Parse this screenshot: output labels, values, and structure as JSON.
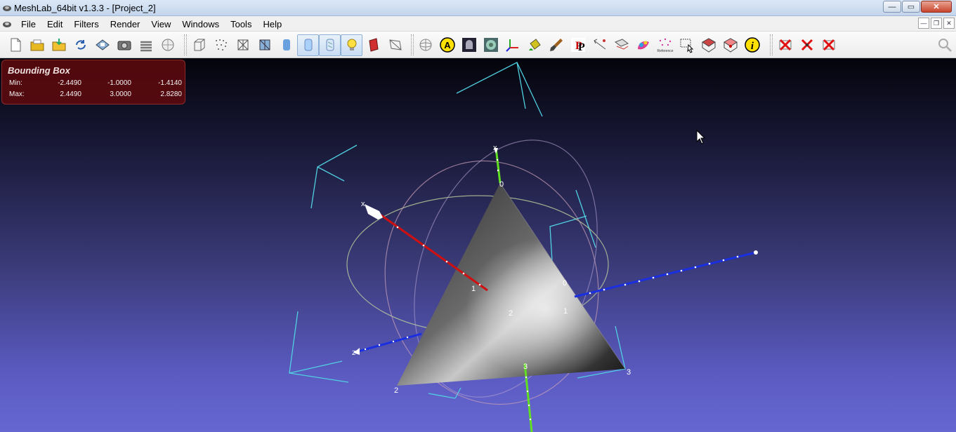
{
  "window": {
    "title": "MeshLab_64bit v1.3.3 - [Project_2]",
    "controls": {
      "minimize": "—",
      "maximize": "▭",
      "close": "✕"
    }
  },
  "menubar": {
    "items": [
      {
        "label": "File"
      },
      {
        "label": "Edit"
      },
      {
        "label": "Filters"
      },
      {
        "label": "Render"
      },
      {
        "label": "View"
      },
      {
        "label": "Windows"
      },
      {
        "label": "Tools"
      },
      {
        "label": "Help"
      }
    ],
    "mdi_controls": {
      "minimize": "—",
      "restore": "❐",
      "close": "✕"
    }
  },
  "toolbar": {
    "icons": [
      "new-project-icon",
      "open-project-icon",
      "import-mesh-icon",
      "reload-icon",
      "save-icon",
      "snapshot-icon",
      "layers-icon",
      "trackball-icon",
      "bounding-box-icon",
      "points-icon",
      "wireframe-icon",
      "flat-lines-icon",
      "flat-icon",
      "smooth-icon",
      "texture-icon",
      "light-icon",
      "color-icon",
      "back-face-icon",
      "sphere-grid-icon",
      "annotation-icon",
      "ambient-occlusion-icon",
      "shader-icon",
      "axes-icon",
      "paint-bucket-icon",
      "brush-icon",
      "pickpoints-icon",
      "measure-icon",
      "align-icon",
      "color-paint-icon",
      "reference-icon",
      "select-faces-icon",
      "select-component-icon",
      "select-vertex-icon",
      "info-icon",
      "delete-faces-icon",
      "delete-vertices-icon",
      "delete-all-icon"
    ],
    "reference_label": "Reference"
  },
  "bounding_box": {
    "title": "Bounding Box",
    "rows": [
      {
        "label": "Min:",
        "x": "-2.4490",
        "y": "-1.0000",
        "z": "-1.4140"
      },
      {
        "label": "Max:",
        "x": "2.4490",
        "y": "3.0000",
        "z": "2.8280"
      }
    ]
  },
  "scene_labels": {
    "top_vertex": "0",
    "right_inner": "0",
    "bottom_center": "3",
    "right_corner": "3",
    "left_corner": "2",
    "center_2": "2",
    "center_1": "1",
    "red_axis_1": "1",
    "axis_x_top": "x",
    "axis_x_left": "x",
    "axis_z": "z"
  },
  "colors": {
    "x_axis": "#d01010",
    "y_axis": "#60e020",
    "z_axis": "#1a30e0",
    "camera_frames": "#50d0e0",
    "bbox_panel": "#5a0a0e"
  }
}
